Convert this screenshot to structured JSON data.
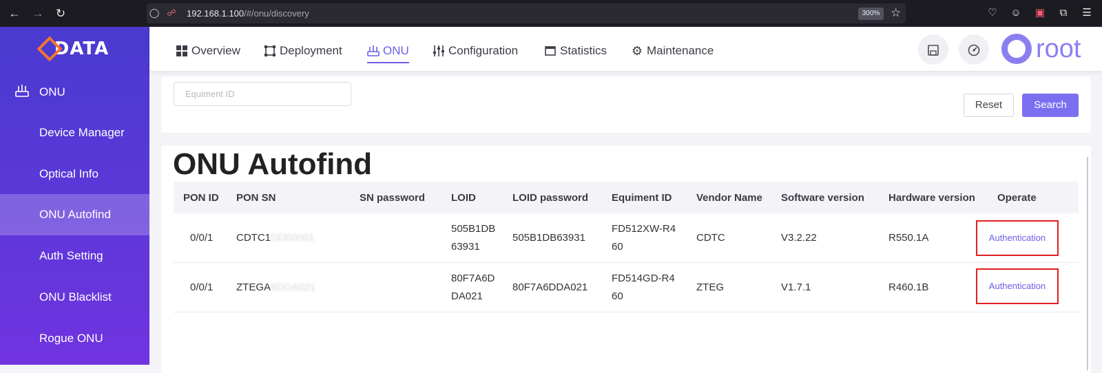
{
  "browser": {
    "url_host": "192.168.1.100",
    "url_path": "/#/onu/discovery",
    "zoom": "300%"
  },
  "sidebar": {
    "logo_text": "DATA",
    "section_label": "ONU",
    "items": [
      {
        "label": "Device Manager"
      },
      {
        "label": "Optical Info"
      },
      {
        "label": "ONU Autofind",
        "active": true
      },
      {
        "label": "Auth Setting"
      },
      {
        "label": "ONU Blacklist"
      },
      {
        "label": "Rogue ONU"
      }
    ]
  },
  "topnav": {
    "tabs": [
      {
        "label": "Overview",
        "icon": "grid-icon"
      },
      {
        "label": "Deployment",
        "icon": "nodes-icon"
      },
      {
        "label": "ONU",
        "icon": "router-icon",
        "active": true
      },
      {
        "label": "Configuration",
        "icon": "sliders-icon"
      },
      {
        "label": "Statistics",
        "icon": "window-icon"
      },
      {
        "label": "Maintenance",
        "icon": "gear-icon"
      }
    ],
    "user_name": "root"
  },
  "filter": {
    "equipment_placeholder": "Equiment ID",
    "equipment_value": "",
    "reset_label": "Reset",
    "search_label": "Search"
  },
  "main": {
    "title": "ONU Autofind",
    "columns": [
      "PON ID",
      "PON SN",
      "SN password",
      "LOID",
      "LOID password",
      "Equiment ID",
      "Vendor Name",
      "Software version",
      "Hardware version",
      "Operate"
    ],
    "rows": [
      {
        "pon_id": "0/0/1",
        "pon_sn_visible": "CDTC1",
        "pon_sn_blurred": "DD00001",
        "sn_password": "",
        "loid_line1": "505B1DB",
        "loid_line2": "63931",
        "loid_password": "505B1DB63931",
        "equipment_line1": "FD512XW-R4",
        "equipment_line2": "60",
        "vendor": "CDTC",
        "software": "V3.2.22",
        "hardware": "R550.1A",
        "operate": "Authentication"
      },
      {
        "pon_id": "0/0/1",
        "pon_sn_visible": "ZTEGA",
        "pon_sn_blurred": "6DDA021",
        "sn_password": "",
        "loid_line1": "80F7A6D",
        "loid_line2": "DA021",
        "loid_password": "80F7A6DDA021",
        "equipment_line1": "FD514GD-R4",
        "equipment_line2": "60",
        "vendor": "ZTEG",
        "software": "V1.7.1",
        "hardware": "R460.1B",
        "operate": "Authentication"
      }
    ]
  },
  "colors": {
    "accent": "#7b6ff0",
    "highlight_border": "#e21e1e",
    "sidebar_top": "#4a3ad0",
    "sidebar_bottom": "#7133e0"
  }
}
